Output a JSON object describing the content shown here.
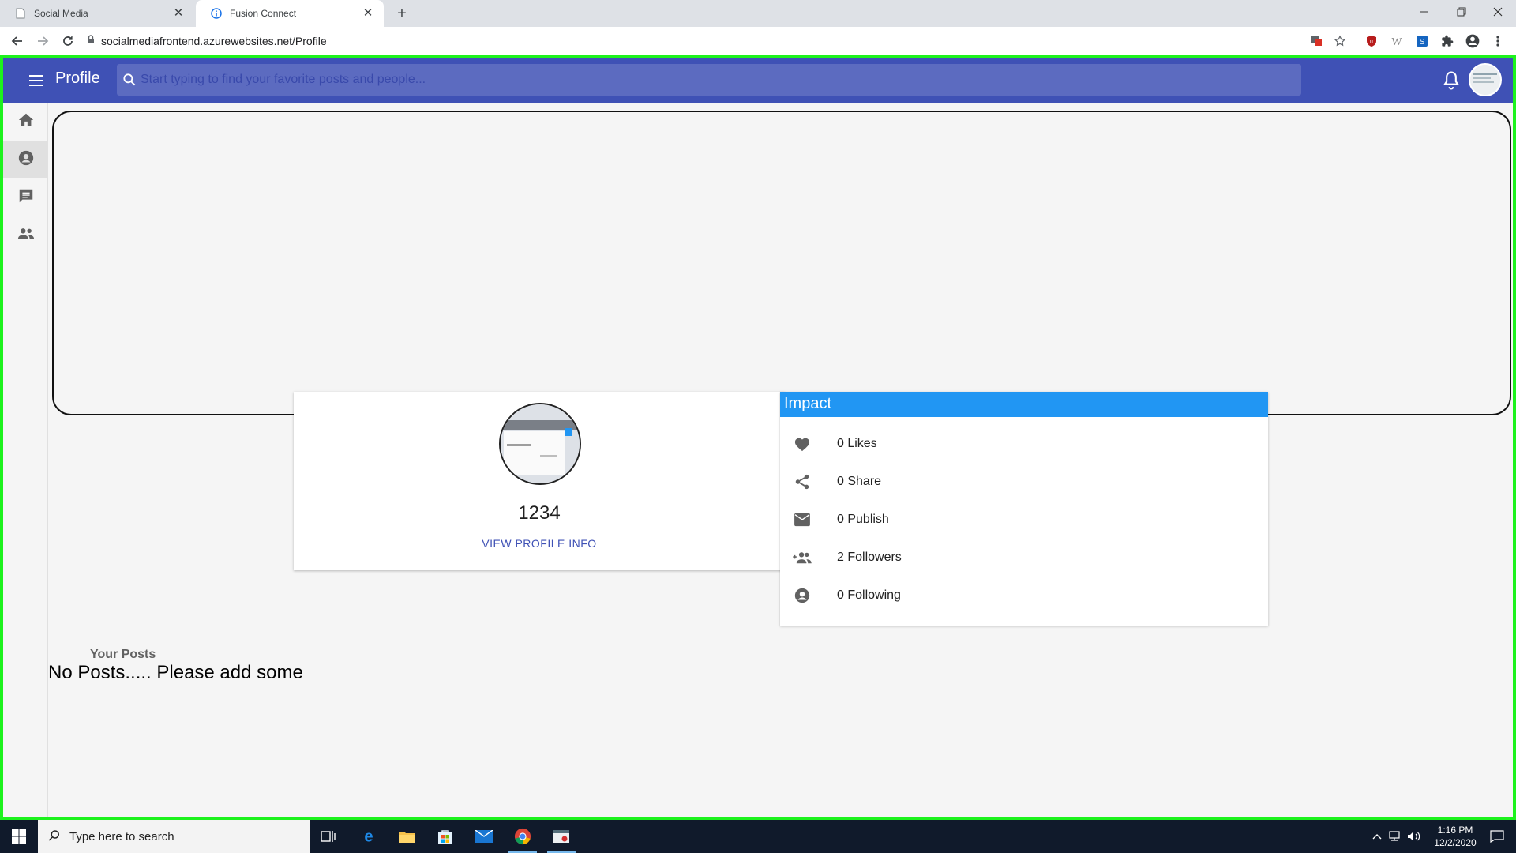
{
  "browser": {
    "tabs": [
      {
        "title": "Social Media",
        "active": false
      },
      {
        "title": "Fusion Connect",
        "active": true
      }
    ],
    "url": "socialmediafrontend.azurewebsites.net/Profile"
  },
  "appbar": {
    "title": "Profile",
    "search_placeholder": "Start typing to find your favorite posts and people..."
  },
  "sidebar": {
    "items": [
      {
        "icon": "home-icon",
        "selected": false
      },
      {
        "icon": "account-icon",
        "selected": true
      },
      {
        "icon": "chat-icon",
        "selected": false
      },
      {
        "icon": "people-icon",
        "selected": false
      }
    ]
  },
  "profile": {
    "name": "1234",
    "link_label": "VIEW PROFILE INFO"
  },
  "impact": {
    "title": "Impact",
    "rows": [
      {
        "icon": "heart-icon",
        "label": "0 Likes"
      },
      {
        "icon": "share-icon",
        "label": "0 Share"
      },
      {
        "icon": "mail-icon",
        "label": "0 Publish"
      },
      {
        "icon": "followers-icon",
        "label": "2 Followers"
      },
      {
        "icon": "account-icon",
        "label": "0 Following"
      }
    ]
  },
  "posts": {
    "heading": "Your Posts",
    "empty_message": "No Posts..... Please add some"
  },
  "taskbar": {
    "search_placeholder": "Type here to search",
    "time": "1:16 PM",
    "date": "12/2/2020"
  },
  "colors": {
    "appbar": "#3f51b5",
    "impact_header": "#2196f3",
    "frame_outline": "#1df21d"
  }
}
